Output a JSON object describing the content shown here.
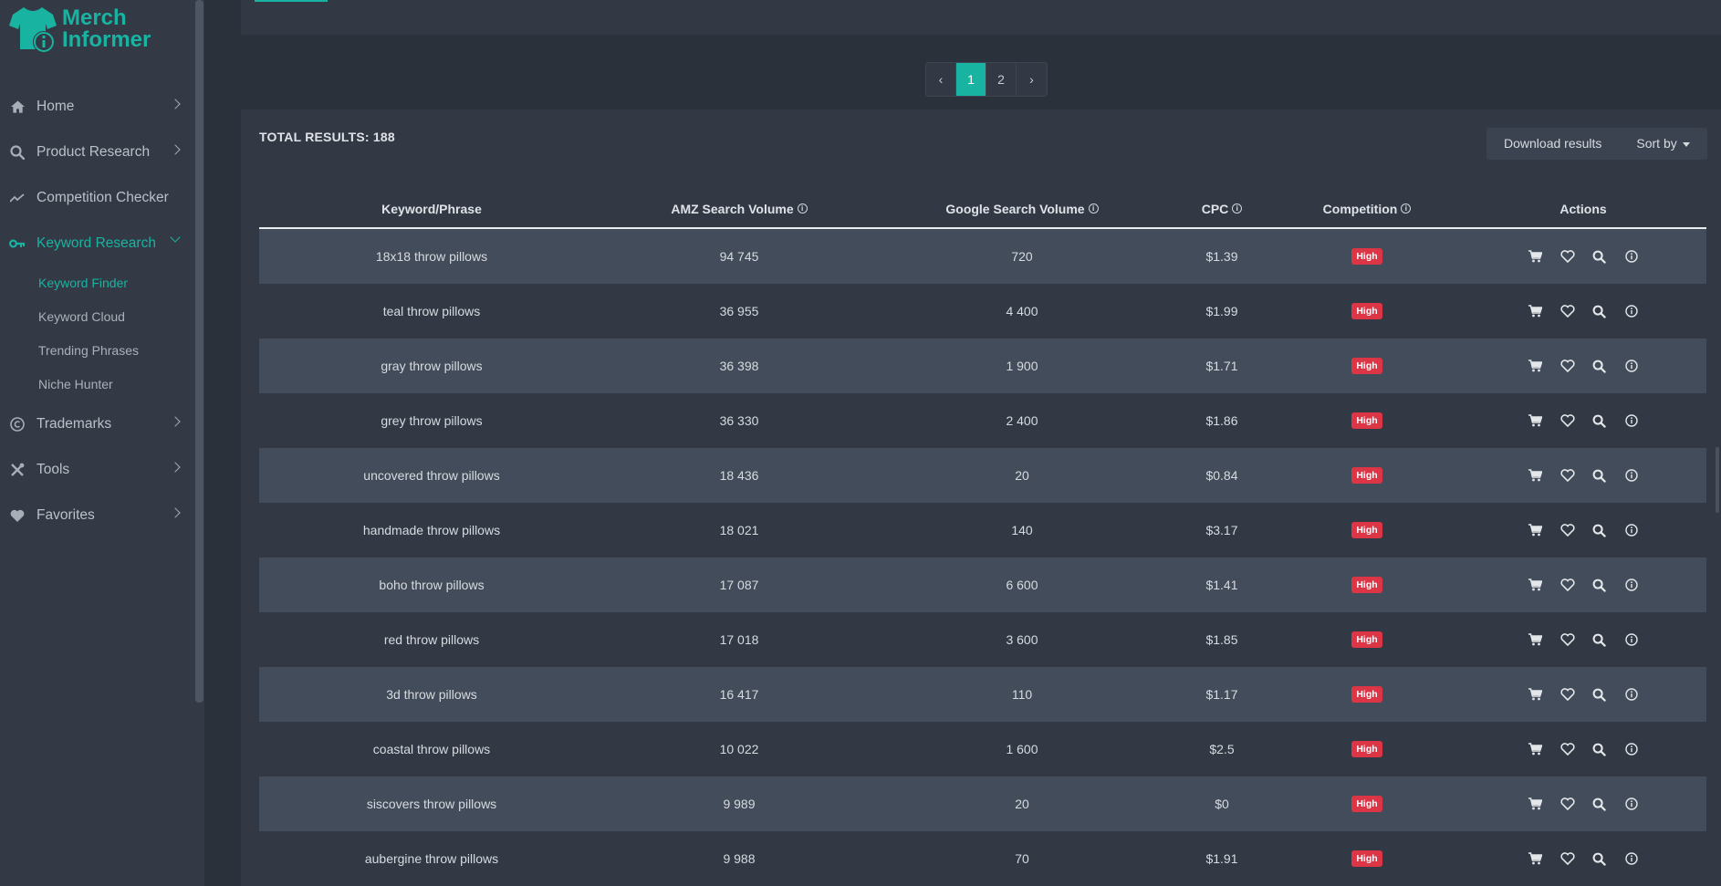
{
  "brand": {
    "line1": "Merch",
    "line2": "Informer",
    "color": "#19b3a2"
  },
  "sidebar": {
    "items": [
      {
        "label": "Home",
        "icon": "home-icon"
      },
      {
        "label": "Product Research",
        "icon": "search-icon"
      },
      {
        "label": "Competition Checker",
        "icon": "trending-icon"
      },
      {
        "label": "Keyword Research",
        "icon": "key-icon"
      },
      {
        "label": "Trademarks",
        "icon": "copyright-icon"
      },
      {
        "label": "Tools",
        "icon": "tools-icon"
      },
      {
        "label": "Favorites",
        "icon": "heart-icon"
      }
    ],
    "sub_items": [
      {
        "label": "Keyword Finder"
      },
      {
        "label": "Keyword Cloud"
      },
      {
        "label": "Trending Phrases"
      },
      {
        "label": "Niche Hunter"
      }
    ]
  },
  "pagination": {
    "prev": "‹",
    "pages": [
      "1",
      "2"
    ],
    "next": "›",
    "current": "1"
  },
  "results": {
    "total_label": "TOTAL RESULTS: 188",
    "download_label": "Download results",
    "sort_label": "Sort by"
  },
  "table": {
    "headers": [
      "Keyword/Phrase",
      "AMZ Search Volume",
      "Google Search Volume",
      "CPC",
      "Competition",
      "Actions"
    ],
    "rows": [
      {
        "keyword": "18x18 throw pillows",
        "amz": "94 745",
        "google": "720",
        "cpc": "$1.39",
        "competition": "High"
      },
      {
        "keyword": "teal throw pillows",
        "amz": "36 955",
        "google": "4 400",
        "cpc": "$1.99",
        "competition": "High"
      },
      {
        "keyword": "gray throw pillows",
        "amz": "36 398",
        "google": "1 900",
        "cpc": "$1.71",
        "competition": "High"
      },
      {
        "keyword": "grey throw pillows",
        "amz": "36 330",
        "google": "2 400",
        "cpc": "$1.86",
        "competition": "High"
      },
      {
        "keyword": "uncovered throw pillows",
        "amz": "18 436",
        "google": "20",
        "cpc": "$0.84",
        "competition": "High"
      },
      {
        "keyword": "handmade throw pillows",
        "amz": "18 021",
        "google": "140",
        "cpc": "$3.17",
        "competition": "High"
      },
      {
        "keyword": "boho throw pillows",
        "amz": "17 087",
        "google": "6 600",
        "cpc": "$1.41",
        "competition": "High"
      },
      {
        "keyword": "red throw pillows",
        "amz": "17 018",
        "google": "3 600",
        "cpc": "$1.85",
        "competition": "High"
      },
      {
        "keyword": "3d throw pillows",
        "amz": "16 417",
        "google": "110",
        "cpc": "$1.17",
        "competition": "High"
      },
      {
        "keyword": "coastal throw pillows",
        "amz": "10 022",
        "google": "1 600",
        "cpc": "$2.5",
        "competition": "High"
      },
      {
        "keyword": "siscovers throw pillows",
        "amz": "9 989",
        "google": "20",
        "cpc": "$0",
        "competition": "High"
      },
      {
        "keyword": "aubergine throw pillows",
        "amz": "9 988",
        "google": "70",
        "cpc": "$1.91",
        "competition": "High"
      }
    ]
  },
  "colors": {
    "accent": "#19b3a2",
    "badge_high": "#dc3545"
  }
}
